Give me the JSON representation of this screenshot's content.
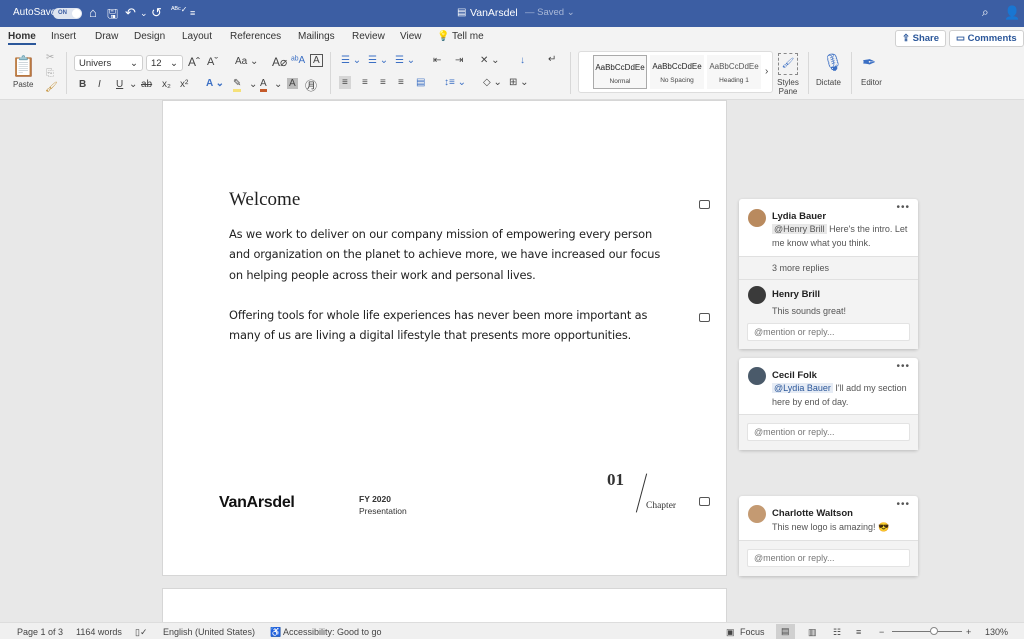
{
  "titlebar": {
    "autosave": "AutoSave",
    "toggle": "ON",
    "doc_name": "VanArsdel",
    "saved": "— Saved ⌄",
    "icons": [
      "home-icon",
      "save-icon",
      "undo-icon",
      "redo-icon",
      "spelling-icon",
      "customize-icon",
      "search-icon",
      "share-person-icon"
    ]
  },
  "tabs": [
    "Home",
    "Insert",
    "Draw",
    "Design",
    "Layout",
    "References",
    "Mailings",
    "Review",
    "View",
    "Tell me"
  ],
  "header_buttons": {
    "share": "Share",
    "comments": "Comments"
  },
  "ribbon": {
    "paste": "Paste",
    "font": "Univers",
    "size": "12",
    "change_case": "Aa",
    "styles": [
      {
        "preview": "AaBbCcDdEe",
        "name": "Normal"
      },
      {
        "preview": "AaBbCcDdEe",
        "name": "No Spacing"
      },
      {
        "preview": "AaBbCcDdEe",
        "name": "Heading 1"
      }
    ],
    "styles_pane": "Styles Pane",
    "dictate": "Dictate",
    "editor": "Editor",
    "format": {
      "bold": "B",
      "italic": "I",
      "underline": "U",
      "strike": "ab",
      "subscript": "x₂",
      "superscript": "x²"
    }
  },
  "document": {
    "heading": "Welcome",
    "paragraphs": [
      "As we work to deliver on our company mission of empowering every person and organization on the planet to achieve more, we have increased our focus on helping people across their work and personal lives.",
      "Offering tools for whole life experiences has never been more important as many of us are living a digital lifestyle that presents more opportunities."
    ],
    "logo": "VanArsdel",
    "fy": "FY 2020",
    "presentation": "Presentation",
    "chapter_num": "01",
    "chapter": "Chapter"
  },
  "comments": [
    {
      "author": "Lydia Bauer",
      "mention": "@Henry Brill",
      "text": "Here's the intro. Let me know what you think.",
      "more_replies": "3 more replies",
      "reply": {
        "author": "Henry Brill",
        "text": "This sounds great!"
      },
      "placeholder": "@mention or reply..."
    },
    {
      "author": "Cecil Folk",
      "mention": "@Lydia Bauer",
      "text": "I'll add my section here by end of day.",
      "placeholder": "@mention or reply..."
    },
    {
      "author": "Charlotte Waltson",
      "text": "This new logo is amazing! 😎",
      "placeholder": "@mention or reply..."
    }
  ],
  "status": {
    "page": "Page 1 of 3",
    "words": "1164 words",
    "language": "English (United States)",
    "accessibility": "Accessibility: Good to go",
    "focus": "Focus",
    "zoom": "130%",
    "zoom_level": 0.6
  }
}
